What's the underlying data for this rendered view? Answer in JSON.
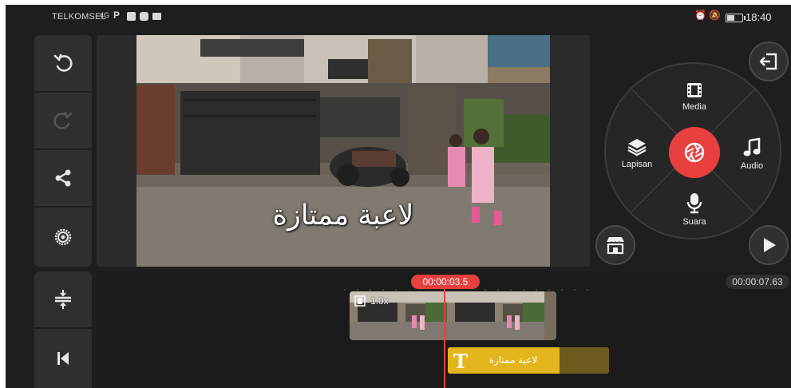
{
  "status_bar": {
    "carrier": "TELKOMSEL",
    "network": "4G",
    "time": "18:40",
    "icons": [
      "signal-icon",
      "parking-icon",
      "gallery-icon",
      "youtube-icon",
      "mail-icon",
      "alarm-icon",
      "mute-icon",
      "battery-icon"
    ]
  },
  "left_toolbar": {
    "buttons": [
      "undo-icon",
      "redo-icon",
      "share-icon",
      "settings-icon"
    ],
    "timeline_buttons": [
      "track-adjust-icon",
      "skip-to-start-icon"
    ]
  },
  "preview": {
    "caption": "لاعبة ممتازة"
  },
  "media_wheel": {
    "media_label": "Media",
    "layer_label": "Lapisan",
    "audio_label": "Audio",
    "voice_label": "Suara"
  },
  "controls": {
    "exit": "exit-icon",
    "store": "store-icon",
    "play": "play-icon"
  },
  "timeline": {
    "current_time": "00:00:03.5",
    "total_time": "00:00:07.63",
    "video_clip": {
      "speed": "1.0x"
    },
    "text_clip": {
      "text": "لاعبة ممتازة"
    }
  },
  "colors": {
    "accent": "#e8403f",
    "text_clip": "#e2b61c",
    "panel": "#2f2f2f",
    "background": "#1e1e1e"
  }
}
